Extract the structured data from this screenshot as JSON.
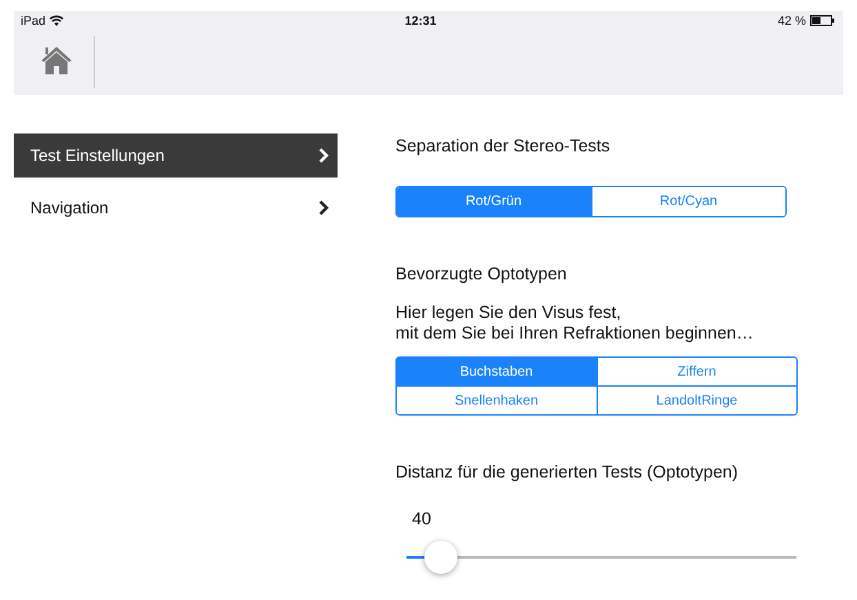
{
  "status_bar": {
    "device": "iPad",
    "time": "12:31",
    "battery": "42 %"
  },
  "sidebar": {
    "items": [
      {
        "label": "Test Einstellungen",
        "selected": true
      },
      {
        "label": "Navigation",
        "selected": false
      }
    ]
  },
  "sections": [
    {
      "kind": "segments",
      "title": "Separation der Stereo-Tests",
      "options": [
        {
          "label": "Rot/Grün",
          "selected": true
        },
        {
          "label": "Rot/Cyan",
          "selected": false
        }
      ]
    },
    {
      "kind": "grid",
      "title": "Bevorzugte Optotypen",
      "description": "Hier legen Sie den Visus fest,\nmit dem Sie bei Ihren Refraktionen beginnen…",
      "options": [
        {
          "label": "Buchstaben",
          "selected": true
        },
        {
          "label": "Ziffern",
          "selected": false
        },
        {
          "label": "Snellenhaken",
          "selected": false
        },
        {
          "label": "LandoltRinge",
          "selected": false
        }
      ]
    },
    {
      "kind": "slider",
      "title": "Distanz für die generierten Tests (Optotypen)",
      "value": "40",
      "level": 0.09
    }
  ]
}
